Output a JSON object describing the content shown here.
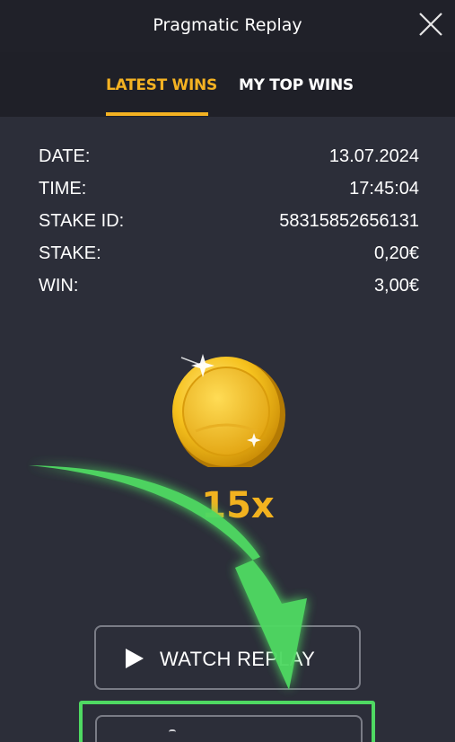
{
  "window": {
    "title": "Pragmatic Replay",
    "close_icon": "close-icon"
  },
  "tabs": [
    {
      "label": "LATEST WINS",
      "active": true
    },
    {
      "label": "MY TOP WINS",
      "active": false
    }
  ],
  "details": [
    {
      "key": "DATE:",
      "value": "13.07.2024"
    },
    {
      "key": "TIME:",
      "value": "17:45:04"
    },
    {
      "key": "STAKE ID:",
      "value": "58315852656131"
    },
    {
      "key": "STAKE:",
      "value": "0,20€"
    },
    {
      "key": "WIN:",
      "value": "3,00€"
    }
  ],
  "win_display": {
    "icon": "gold-coin-icon",
    "multiplier": "15x"
  },
  "buttons": {
    "watch_replay": "WATCH REPLAY"
  },
  "colors": {
    "accent": "#f4b222",
    "background": "#2c2e39",
    "header": "#202129",
    "highlight": "#4fd962"
  }
}
